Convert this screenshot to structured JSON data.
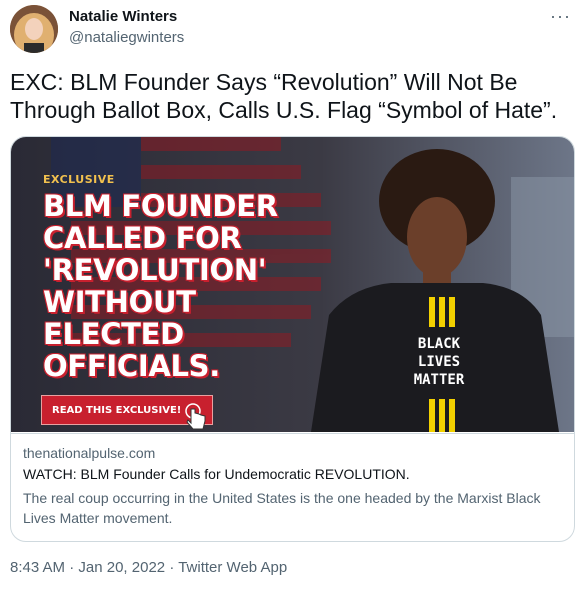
{
  "author": {
    "name": "Natalie Winters",
    "handle": "@nataliegwinters"
  },
  "more_icon": "more-icon",
  "tweet_text": "EXC: BLM Founder Says “Revolution” Will Not Be Through Ballot Box, Calls U.S. Flag “Symbol of Hate”.",
  "card": {
    "image": {
      "tag": "EXCLUSIVE",
      "headline_lines": [
        "BLM FOUNDER",
        "CALLED FOR",
        "'REVOLUTION'",
        "WITHOUT",
        "ELECTED",
        "OFFICIALS."
      ],
      "button": "READ THIS EXCLUSIVE!",
      "shirt_lines": [
        "BLACK",
        "LIVES",
        "MATTER"
      ]
    },
    "domain": "thenationalpulse.com",
    "title": "WATCH: BLM Founder Calls for Undemocratic REVOLUTION.",
    "description": "The real coup occurring in the United States is the one headed by the Marxist Black Lives Matter movement."
  },
  "meta": {
    "time": "8:43 AM",
    "separator": "·",
    "date": "Jan 20, 2022",
    "app": "Twitter Web App"
  },
  "colors": {
    "accent_red": "#c8202e",
    "tag_yellow": "#f2c14e",
    "text_secondary": "#536471"
  }
}
